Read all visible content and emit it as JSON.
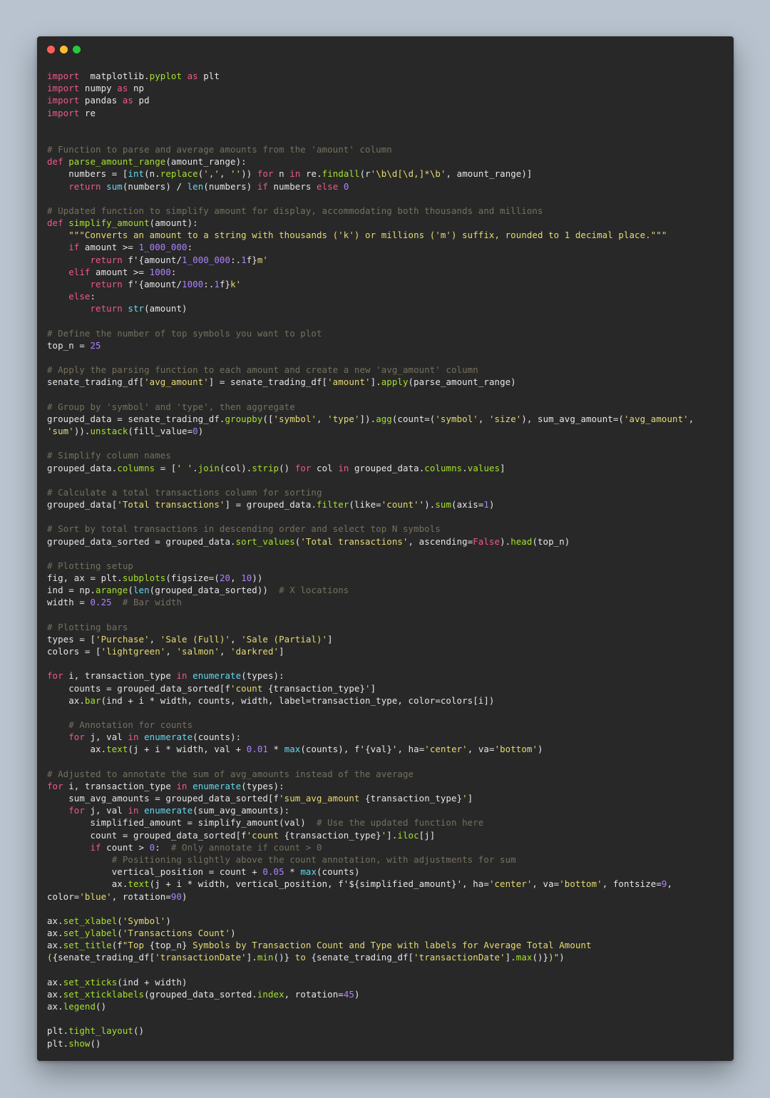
{
  "window": {
    "controls": [
      {
        "name": "close",
        "color": "#ff5f56"
      },
      {
        "name": "minimize",
        "color": "#ffbd2e"
      },
      {
        "name": "maximize",
        "color": "#27c93f"
      }
    ]
  },
  "syntax_colors": {
    "background": "#282828",
    "default": "#e6e6e6",
    "kw": "#f05a86",
    "fn": "#a6e22e",
    "bi": "#66d9ef",
    "str": "#e6db74",
    "num": "#ae81ff",
    "cm": "#75715e"
  },
  "code_lines": [
    [
      [
        "kw",
        "import"
      ],
      [
        "",
        "  matplotlib."
      ],
      [
        "fn",
        "pyplot"
      ],
      [
        "",
        " "
      ],
      [
        "kw",
        "as"
      ],
      [
        "",
        " plt"
      ]
    ],
    [
      [
        "kw",
        "import"
      ],
      [
        "",
        " numpy "
      ],
      [
        "kw",
        "as"
      ],
      [
        "",
        " np"
      ]
    ],
    [
      [
        "kw",
        "import"
      ],
      [
        "",
        " pandas "
      ],
      [
        "kw",
        "as"
      ],
      [
        "",
        " pd"
      ]
    ],
    [
      [
        "kw",
        "import"
      ],
      [
        "",
        " re"
      ]
    ],
    [],
    [],
    [
      [
        "cm",
        "# Function to parse and average amounts from the 'amount' column"
      ]
    ],
    [
      [
        "kw",
        "def"
      ],
      [
        "",
        " "
      ],
      [
        "fn",
        "parse_amount_range"
      ],
      [
        "",
        "(amount_range):"
      ]
    ],
    [
      [
        "",
        "    numbers = ["
      ],
      [
        "bi",
        "int"
      ],
      [
        "",
        "(n."
      ],
      [
        "fn",
        "replace"
      ],
      [
        "",
        "("
      ],
      [
        "str",
        "','"
      ],
      [
        "",
        ", "
      ],
      [
        "str",
        "''"
      ],
      [
        "",
        ")) "
      ],
      [
        "kw",
        "for"
      ],
      [
        "",
        " n "
      ],
      [
        "kw",
        "in"
      ],
      [
        "",
        " re."
      ],
      [
        "fn",
        "findall"
      ],
      [
        "",
        "(r"
      ],
      [
        "str",
        "'\\b\\d[\\d,]*\\b'"
      ],
      [
        "",
        ", amount_range)]"
      ]
    ],
    [
      [
        "",
        "    "
      ],
      [
        "kw",
        "return"
      ],
      [
        "",
        " "
      ],
      [
        "bi",
        "sum"
      ],
      [
        "",
        "(numbers) / "
      ],
      [
        "bi",
        "len"
      ],
      [
        "",
        "(numbers) "
      ],
      [
        "kw",
        "if"
      ],
      [
        "",
        " numbers "
      ],
      [
        "kw",
        "else"
      ],
      [
        "",
        " "
      ],
      [
        "num",
        "0"
      ]
    ],
    [],
    [
      [
        "cm",
        "# Updated function to simplify amount for display, accommodating both thousands and millions"
      ]
    ],
    [
      [
        "kw",
        "def"
      ],
      [
        "",
        " "
      ],
      [
        "fn",
        "simplify_amount"
      ],
      [
        "",
        "(amount):"
      ]
    ],
    [
      [
        "",
        "    "
      ],
      [
        "str",
        "\"\"\"Converts an amount to a string with thousands ('k') or millions ('m') suffix, rounded to 1 decimal place.\"\"\""
      ]
    ],
    [
      [
        "",
        "    "
      ],
      [
        "kw",
        "if"
      ],
      [
        "",
        " amount >= "
      ],
      [
        "num",
        "1_000_000"
      ],
      [
        "",
        ":"
      ]
    ],
    [
      [
        "",
        "        "
      ],
      [
        "kw",
        "return"
      ],
      [
        "",
        " f'{amount/"
      ],
      [
        "num",
        "1_000_000"
      ],
      [
        "",
        ":."
      ],
      [
        "num",
        "1"
      ],
      [
        "",
        "f}"
      ],
      [
        "str",
        "m'"
      ]
    ],
    [
      [
        "",
        "    "
      ],
      [
        "kw",
        "elif"
      ],
      [
        "",
        " amount >= "
      ],
      [
        "num",
        "1000"
      ],
      [
        "",
        ":"
      ]
    ],
    [
      [
        "",
        "        "
      ],
      [
        "kw",
        "return"
      ],
      [
        "",
        " f'{amount/"
      ],
      [
        "num",
        "1000"
      ],
      [
        "",
        ":."
      ],
      [
        "num",
        "1"
      ],
      [
        "",
        "f}"
      ],
      [
        "str",
        "k'"
      ]
    ],
    [
      [
        "",
        "    "
      ],
      [
        "kw",
        "else"
      ],
      [
        "",
        ":"
      ]
    ],
    [
      [
        "",
        "        "
      ],
      [
        "kw",
        "return"
      ],
      [
        "",
        " "
      ],
      [
        "bi",
        "str"
      ],
      [
        "",
        "(amount)"
      ]
    ],
    [],
    [
      [
        "cm",
        "# Define the number of top symbols you want to plot"
      ]
    ],
    [
      [
        "",
        "top_n = "
      ],
      [
        "num",
        "25"
      ]
    ],
    [],
    [
      [
        "cm",
        "# Apply the parsing function to each amount and create a new 'avg_amount' column"
      ]
    ],
    [
      [
        "",
        "senate_trading_df["
      ],
      [
        "str",
        "'avg_amount'"
      ],
      [
        "",
        "] = senate_trading_df["
      ],
      [
        "str",
        "'amount'"
      ],
      [
        "",
        "]."
      ],
      [
        "fn",
        "apply"
      ],
      [
        "",
        "(parse_amount_range)"
      ]
    ],
    [],
    [
      [
        "cm",
        "# Group by 'symbol' and 'type', then aggregate"
      ]
    ],
    [
      [
        "",
        "grouped_data = senate_trading_df."
      ],
      [
        "fn",
        "groupby"
      ],
      [
        "",
        "(["
      ],
      [
        "str",
        "'symbol'"
      ],
      [
        "",
        ", "
      ],
      [
        "str",
        "'type'"
      ],
      [
        "",
        "])."
      ],
      [
        "fn",
        "agg"
      ],
      [
        "",
        "(count=("
      ],
      [
        "str",
        "'symbol'"
      ],
      [
        "",
        ", "
      ],
      [
        "str",
        "'size'"
      ],
      [
        "",
        "), sum_avg_amount=("
      ],
      [
        "str",
        "'avg_amount'"
      ],
      [
        "",
        ","
      ]
    ],
    [
      [
        "str",
        "'sum'"
      ],
      [
        "",
        "))."
      ],
      [
        "fn",
        "unstack"
      ],
      [
        "",
        "(fill_value="
      ],
      [
        "num",
        "0"
      ],
      [
        "",
        ")"
      ]
    ],
    [],
    [
      [
        "cm",
        "# Simplify column names"
      ]
    ],
    [
      [
        "",
        "grouped_data."
      ],
      [
        "fn",
        "columns"
      ],
      [
        "",
        " = ["
      ],
      [
        "str",
        "' '"
      ],
      [
        "",
        "."
      ],
      [
        "fn",
        "join"
      ],
      [
        "",
        "(col)."
      ],
      [
        "fn",
        "strip"
      ],
      [
        "",
        "() "
      ],
      [
        "kw",
        "for"
      ],
      [
        "",
        " col "
      ],
      [
        "kw",
        "in"
      ],
      [
        "",
        " grouped_data."
      ],
      [
        "fn",
        "columns"
      ],
      [
        "",
        "."
      ],
      [
        "fn",
        "values"
      ],
      [
        "",
        "]"
      ]
    ],
    [],
    [
      [
        "cm",
        "# Calculate a total transactions column for sorting"
      ]
    ],
    [
      [
        "",
        "grouped_data["
      ],
      [
        "str",
        "'Total transactions'"
      ],
      [
        "",
        "] = grouped_data."
      ],
      [
        "fn",
        "filter"
      ],
      [
        "",
        "(like="
      ],
      [
        "str",
        "'count'"
      ],
      [
        "",
        "')."
      ],
      [
        "fn",
        "sum"
      ],
      [
        "",
        "(axis="
      ],
      [
        "num",
        "1"
      ],
      [
        "",
        ")"
      ]
    ],
    [],
    [
      [
        "cm",
        "# Sort by total transactions in descending order and select top N symbols"
      ]
    ],
    [
      [
        "",
        "grouped_data_sorted = grouped_data."
      ],
      [
        "fn",
        "sort_values"
      ],
      [
        "",
        "("
      ],
      [
        "str",
        "'Total transactions'"
      ],
      [
        "",
        ", ascending="
      ],
      [
        "kw",
        "False"
      ],
      [
        "",
        ")."
      ],
      [
        "fn",
        "head"
      ],
      [
        "",
        "(top_n)"
      ]
    ],
    [],
    [
      [
        "cm",
        "# Plotting setup"
      ]
    ],
    [
      [
        "",
        "fig, ax = plt."
      ],
      [
        "fn",
        "subplots"
      ],
      [
        "",
        "(figsize=("
      ],
      [
        "num",
        "20"
      ],
      [
        "",
        ", "
      ],
      [
        "num",
        "10"
      ],
      [
        "",
        "))"
      ]
    ],
    [
      [
        "",
        "ind = np."
      ],
      [
        "fn",
        "arange"
      ],
      [
        "",
        "("
      ],
      [
        "bi",
        "len"
      ],
      [
        "",
        "(grouped_data_sorted))  "
      ],
      [
        "cm",
        "# X locations"
      ]
    ],
    [
      [
        "",
        "width = "
      ],
      [
        "num",
        "0.25"
      ],
      [
        "",
        "  "
      ],
      [
        "cm",
        "# Bar width"
      ]
    ],
    [],
    [
      [
        "cm",
        "# Plotting bars"
      ]
    ],
    [
      [
        "",
        "types = ["
      ],
      [
        "str",
        "'Purchase'"
      ],
      [
        "",
        ", "
      ],
      [
        "str",
        "'Sale (Full)'"
      ],
      [
        "",
        ", "
      ],
      [
        "str",
        "'Sale (Partial)'"
      ],
      [
        "",
        "]"
      ]
    ],
    [
      [
        "",
        "colors = ["
      ],
      [
        "str",
        "'lightgreen'"
      ],
      [
        "",
        ", "
      ],
      [
        "str",
        "'salmon'"
      ],
      [
        "",
        ", "
      ],
      [
        "str",
        "'darkred'"
      ],
      [
        "",
        "]"
      ]
    ],
    [],
    [
      [
        "kw",
        "for"
      ],
      [
        "",
        " i, transaction_type "
      ],
      [
        "kw",
        "in"
      ],
      [
        "",
        " "
      ],
      [
        "bi",
        "enumerate"
      ],
      [
        "",
        "(types):"
      ]
    ],
    [
      [
        "",
        "    counts = grouped_data_sorted[f"
      ],
      [
        "str",
        "'count "
      ],
      [
        "",
        "{transaction_type}"
      ],
      [
        "str",
        "'"
      ],
      [
        "",
        "]"
      ]
    ],
    [
      [
        "",
        "    ax."
      ],
      [
        "fn",
        "bar"
      ],
      [
        "",
        "(ind + i * width, counts, width, label=transaction_type, color=colors[i])"
      ]
    ],
    [],
    [
      [
        "",
        "    "
      ],
      [
        "cm",
        "# Annotation for counts"
      ]
    ],
    [
      [
        "",
        "    "
      ],
      [
        "kw",
        "for"
      ],
      [
        "",
        " j, val "
      ],
      [
        "kw",
        "in"
      ],
      [
        "",
        " "
      ],
      [
        "bi",
        "enumerate"
      ],
      [
        "",
        "(counts):"
      ]
    ],
    [
      [
        "",
        "        ax."
      ],
      [
        "fn",
        "text"
      ],
      [
        "",
        "(j + i * width, val + "
      ],
      [
        "num",
        "0.01"
      ],
      [
        "",
        " * "
      ],
      [
        "bi",
        "max"
      ],
      [
        "",
        "(counts), f'{val}', ha="
      ],
      [
        "str",
        "'center'"
      ],
      [
        "",
        ", va="
      ],
      [
        "str",
        "'bottom'"
      ],
      [
        "",
        ")"
      ]
    ],
    [],
    [
      [
        "cm",
        "# Adjusted to annotate the sum of avg_amounts instead of the average"
      ]
    ],
    [
      [
        "kw",
        "for"
      ],
      [
        "",
        " i, transaction_type "
      ],
      [
        "kw",
        "in"
      ],
      [
        "",
        " "
      ],
      [
        "bi",
        "enumerate"
      ],
      [
        "",
        "(types):"
      ]
    ],
    [
      [
        "",
        "    sum_avg_amounts = grouped_data_sorted[f"
      ],
      [
        "str",
        "'sum_avg_amount "
      ],
      [
        "",
        "{transaction_type}"
      ],
      [
        "str",
        "'"
      ],
      [
        "",
        "]"
      ]
    ],
    [
      [
        "",
        "    "
      ],
      [
        "kw",
        "for"
      ],
      [
        "",
        " j, val "
      ],
      [
        "kw",
        "in"
      ],
      [
        "",
        " "
      ],
      [
        "bi",
        "enumerate"
      ],
      [
        "",
        "(sum_avg_amounts):"
      ]
    ],
    [
      [
        "",
        "        simplified_amount = simplify_amount(val)  "
      ],
      [
        "cm",
        "# Use the updated function here"
      ]
    ],
    [
      [
        "",
        "        count = grouped_data_sorted[f"
      ],
      [
        "str",
        "'count "
      ],
      [
        "",
        "{transaction_type}"
      ],
      [
        "str",
        "'"
      ],
      [
        "",
        "]."
      ],
      [
        "fn",
        "iloc"
      ],
      [
        "",
        "[j]"
      ]
    ],
    [
      [
        "",
        "        "
      ],
      [
        "kw",
        "if"
      ],
      [
        "",
        " count > "
      ],
      [
        "num",
        "0"
      ],
      [
        "",
        ":  "
      ],
      [
        "cm",
        "# Only annotate if count > 0"
      ]
    ],
    [
      [
        "",
        "            "
      ],
      [
        "cm",
        "# Positioning slightly above the count annotation, with adjustments for sum"
      ]
    ],
    [
      [
        "",
        "            vertical_position = count + "
      ],
      [
        "num",
        "0.05"
      ],
      [
        "",
        " * "
      ],
      [
        "bi",
        "max"
      ],
      [
        "",
        "(counts)"
      ]
    ],
    [
      [
        "",
        "            ax."
      ],
      [
        "fn",
        "text"
      ],
      [
        "",
        "(j + i * width, vertical_position, f'${simplified_amount}', ha="
      ],
      [
        "str",
        "'center'"
      ],
      [
        "",
        ", va="
      ],
      [
        "str",
        "'bottom'"
      ],
      [
        "",
        ", fontsize="
      ],
      [
        "num",
        "9"
      ],
      [
        "",
        ","
      ]
    ],
    [
      [
        "",
        "color="
      ],
      [
        "str",
        "'blue'"
      ],
      [
        "",
        ", rotation="
      ],
      [
        "num",
        "90"
      ],
      [
        "",
        ")"
      ]
    ],
    [],
    [
      [
        "",
        "ax."
      ],
      [
        "fn",
        "set_xlabel"
      ],
      [
        "",
        "("
      ],
      [
        "str",
        "'Symbol'"
      ],
      [
        "",
        ")"
      ]
    ],
    [
      [
        "",
        "ax."
      ],
      [
        "fn",
        "set_ylabel"
      ],
      [
        "",
        "("
      ],
      [
        "str",
        "'Transactions Count'"
      ],
      [
        "",
        ")"
      ]
    ],
    [
      [
        "",
        "ax."
      ],
      [
        "fn",
        "set_title"
      ],
      [
        "",
        "(f"
      ],
      [
        "str",
        "\"Top "
      ],
      [
        "",
        "{top_n}"
      ],
      [
        "str",
        " Symbols by Transaction Count and Type with labels for Average Total Amount"
      ]
    ],
    [
      [
        "str",
        "("
      ],
      [
        "",
        "{senate_trading_df["
      ],
      [
        "str",
        "'transactionDate'"
      ],
      [
        "",
        "]."
      ],
      [
        "fn",
        "min"
      ],
      [
        "",
        "()}"
      ],
      [
        "str",
        " to "
      ],
      [
        "",
        "{senate_trading_df["
      ],
      [
        "str",
        "'transactionDate'"
      ],
      [
        "",
        "]."
      ],
      [
        "fn",
        "max"
      ],
      [
        "",
        "()}"
      ],
      [
        "str",
        ")\""
      ],
      [
        "",
        ")"
      ]
    ],
    [],
    [
      [
        "",
        "ax."
      ],
      [
        "fn",
        "set_xticks"
      ],
      [
        "",
        "(ind + width)"
      ]
    ],
    [
      [
        "",
        "ax."
      ],
      [
        "fn",
        "set_xticklabels"
      ],
      [
        "",
        "(grouped_data_sorted."
      ],
      [
        "fn",
        "index"
      ],
      [
        "",
        ", rotation="
      ],
      [
        "num",
        "45"
      ],
      [
        "",
        ")"
      ]
    ],
    [
      [
        "",
        "ax."
      ],
      [
        "fn",
        "legend"
      ],
      [
        "",
        "()"
      ]
    ],
    [],
    [
      [
        "",
        "plt."
      ],
      [
        "fn",
        "tight_layout"
      ],
      [
        "",
        "()"
      ]
    ],
    [
      [
        "",
        "plt."
      ],
      [
        "fn",
        "show"
      ],
      [
        "",
        "()"
      ]
    ]
  ]
}
